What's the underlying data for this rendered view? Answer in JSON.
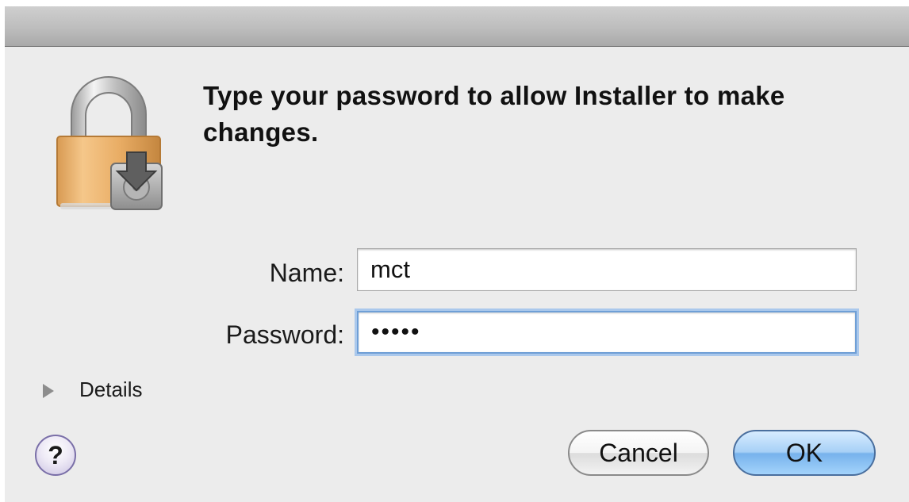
{
  "dialog": {
    "prompt": "Type your password to allow Installer to make changes."
  },
  "form": {
    "name_label": "Name:",
    "name_value": "mct",
    "password_label": "Password:",
    "password_mask": "•••••"
  },
  "details": {
    "label": "Details"
  },
  "buttons": {
    "help": "?",
    "cancel": "Cancel",
    "ok": "OK"
  },
  "icons": {
    "lock": "lock-installer-icon",
    "disclosure": "disclosure-triangle-icon"
  },
  "colors": {
    "dialog_background": "#ececec",
    "focus_ring": "#6f9fd6",
    "ok_button": "#77b2ec",
    "lock_body": "#e6a85c"
  }
}
